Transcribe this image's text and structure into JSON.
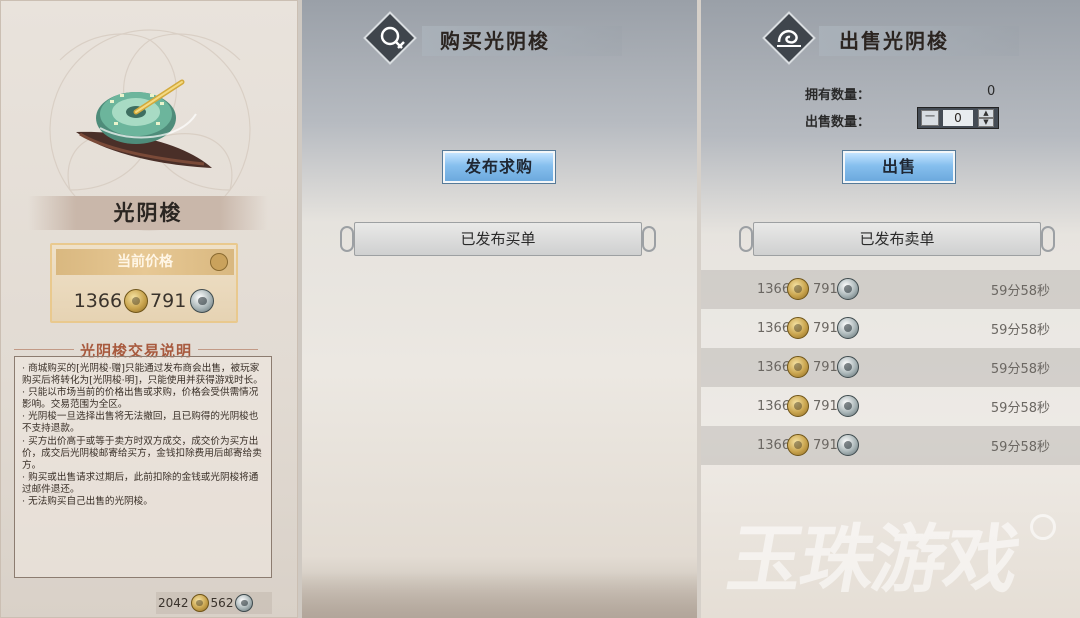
{
  "item": {
    "name": "光阴梭",
    "price_label": "当前价格",
    "price_gold": "1366",
    "price_silver": "791",
    "explain_title": "光阴梭交易说明",
    "explain_lines": [
      "· 商城购买的[光阴梭·赠]只能通过发布商会出售，被玩家购买后将转化为[光阴梭·明]，只能使用并获得游戏时长。",
      "· 只能以市场当前的价格出售或求购，价格会受供需情况影响。交易范围为全区。",
      "· 光阴梭一旦选择出售将无法撤回，且已购得的光阴梭也不支持退款。",
      "· 买方出价高于或等于卖方时双方成交，成交价为买方出价，成交后光阴梭邮寄给买方，金钱扣除费用后邮寄给卖方。",
      "· 购买或出售请求过期后，此前扣除的金钱或光阴梭将通过邮件退还。",
      "· 无法购买自己出售的光阴梭。"
    ],
    "balance_gold": "2042",
    "balance_silver": "562"
  },
  "buy_panel": {
    "title": "购买光阴梭",
    "action_label": "发布求购",
    "list_title": "已发布买单"
  },
  "sell_panel": {
    "title": "出售光阴梭",
    "owned_label": "拥有数量：",
    "owned_value": "0",
    "sell_qty_label": "出售数量：",
    "sell_qty_value": "0",
    "stepper_minus": "一",
    "action_label": "出售",
    "list_title": "已发布卖单",
    "orders": [
      {
        "gold": "1366",
        "silver": "791",
        "time": "59分58秒"
      },
      {
        "gold": "1366",
        "silver": "791",
        "time": "59分58秒"
      },
      {
        "gold": "1366",
        "silver": "791",
        "time": "59分58秒"
      },
      {
        "gold": "1366",
        "silver": "791",
        "time": "59分58秒"
      },
      {
        "gold": "1366",
        "silver": "791",
        "time": "59分58秒"
      }
    ]
  },
  "watermark": "玉珠游戏",
  "icons": {
    "gold_coin": "gold-coin-icon",
    "silver_coin": "silver-coin-icon"
  }
}
